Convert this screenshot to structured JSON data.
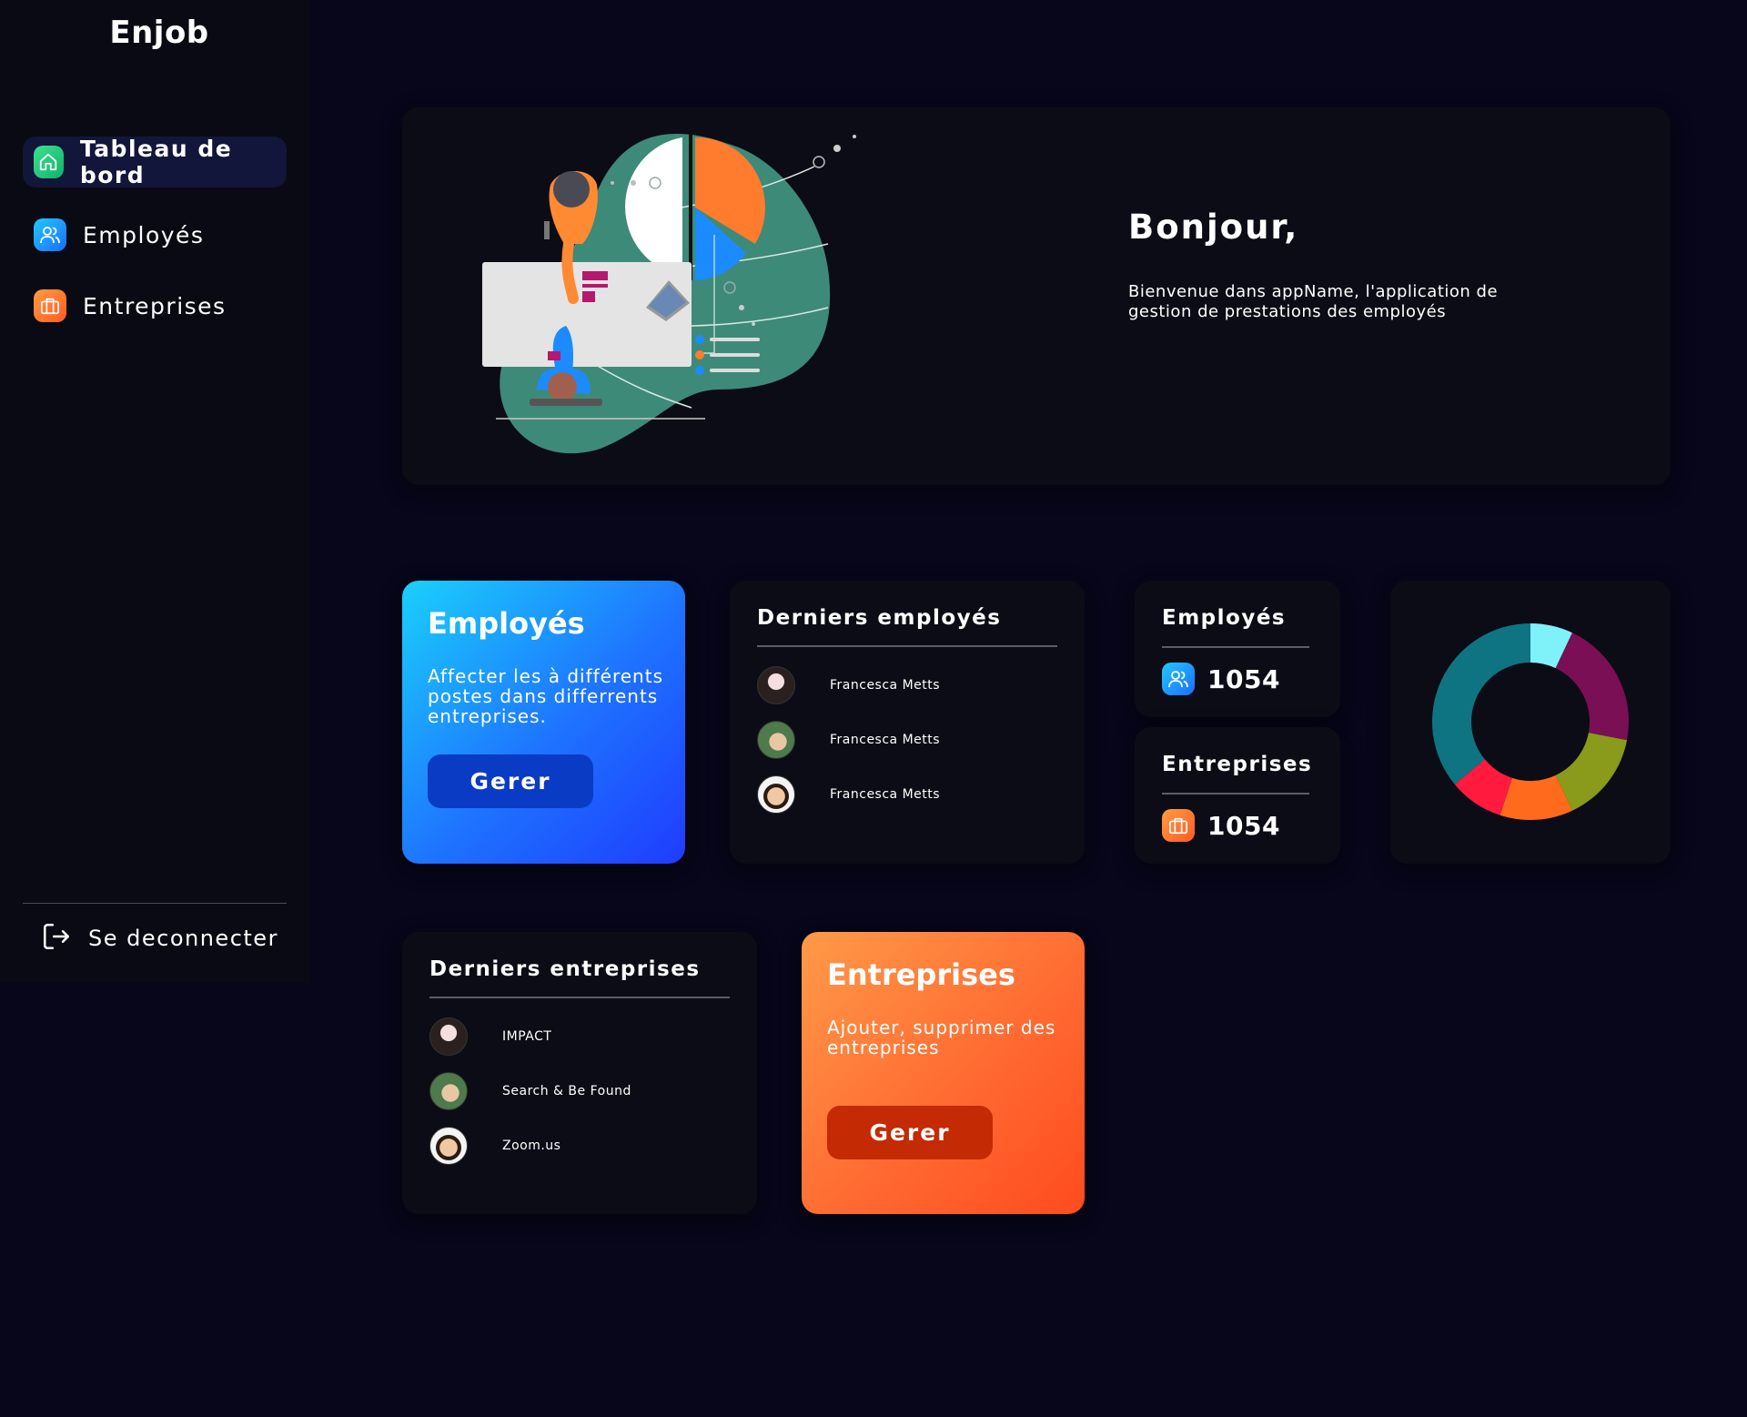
{
  "sidebar": {
    "brand": "Enjob",
    "items": [
      {
        "label": "Tableau de bord",
        "icon": "home-icon"
      },
      {
        "label": "Employés",
        "icon": "users-icon"
      },
      {
        "label": "Entreprises",
        "icon": "briefcase-icon"
      }
    ],
    "logout_label": "Se deconnecter"
  },
  "hero": {
    "title": "Bonjour,",
    "subtitle": "Bienvenue dans appName, l'application de gestion de prestations des employés"
  },
  "employees_card": {
    "title": "Employés",
    "description": "Affecter les à différents postes dans differrents entreprises.",
    "button_label": "Gerer"
  },
  "recent_employees": {
    "title": "Derniers employés",
    "items": [
      {
        "name": "Francesca Metts"
      },
      {
        "name": "Francesca Metts"
      },
      {
        "name": "Francesca Metts"
      }
    ]
  },
  "stats": {
    "employees": {
      "title": "Employés",
      "value": "1054"
    },
    "companies": {
      "title": "Entreprises",
      "value": "1054"
    }
  },
  "recent_companies": {
    "title": "Derniers entreprises",
    "items": [
      {
        "name": "IMPACT"
      },
      {
        "name": "Search & Be Found"
      },
      {
        "name": "Zoom.us"
      }
    ]
  },
  "companies_card": {
    "title": "Entreprises",
    "description": "Ajouter, supprimer des entreprises",
    "button_label": "Gerer"
  },
  "chart_data": {
    "type": "pie",
    "title": "",
    "slices": [
      {
        "value": 7,
        "color": "#7ef2f8"
      },
      {
        "value": 21,
        "color": "#7a0f55"
      },
      {
        "value": 15,
        "color": "#8a9a1a"
      },
      {
        "value": 12,
        "color": "#ff6a1c"
      },
      {
        "value": 9,
        "color": "#ff1a3e"
      },
      {
        "value": 36,
        "color": "#0e7482"
      }
    ]
  },
  "colors": {
    "background": "#07061a",
    "card": "#0c0c16",
    "blue_gradient": [
      "#1ad0fb",
      "#1f3cff"
    ],
    "orange_gradient": [
      "#ff9a48",
      "#ff4b1e"
    ],
    "blue_button": "#0a3bc4",
    "orange_button": "#c42a04"
  }
}
